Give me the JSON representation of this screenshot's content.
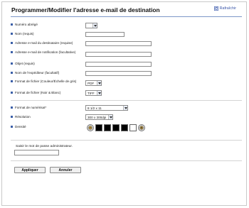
{
  "page": {
    "title": "Programmer/Modifier l'adresse e-mail de destination",
    "refresh_label": "Rafraîchir"
  },
  "fields": {
    "numero_abrege": {
      "label": "Numéro abrégé",
      "value": ""
    },
    "nom": {
      "label": "Nom (requis)",
      "value": ""
    },
    "adresse_destinataire": {
      "label": "Adresse e-mail du destinataire (requise)",
      "value": ""
    },
    "adresse_notification": {
      "label": "Adresse e-mail de notification (facultative)",
      "value": ""
    },
    "objet": {
      "label": "Objet (requis)",
      "value": ""
    },
    "nom_expediteur": {
      "label": "Nom de l'expéditeur (facultatif)",
      "value": ""
    },
    "format_couleur": {
      "label": "Format de fichier (Couleur/Échelle de gris)",
      "value": "PDF"
    },
    "format_nb": {
      "label": "Format de fichier (Noir & Blanc)",
      "value": "TIFF"
    },
    "format_numerisation": {
      "label": "Format de numérisat*",
      "value": "8 1/2 x 11"
    },
    "resolution": {
      "label": "Résolution",
      "value": "300 x 300dpi"
    },
    "densite": {
      "label": "Densité",
      "level": 4,
      "levels": 7
    }
  },
  "password": {
    "label": "Saisir le mot de passe administrateur.",
    "value": ""
  },
  "buttons": {
    "apply": "Appliquer",
    "cancel": "Annuler"
  },
  "colors": {
    "accent": "#3b5fa8",
    "rule": "#7e97c8",
    "swatch_dark": "#000000",
    "swatch_light": "#ffffff"
  },
  "icons": {
    "refresh": "refresh-icon",
    "dropdown": "chevron-down-icon",
    "minus": "density-decrease-icon",
    "plus": "density-increase-icon"
  }
}
